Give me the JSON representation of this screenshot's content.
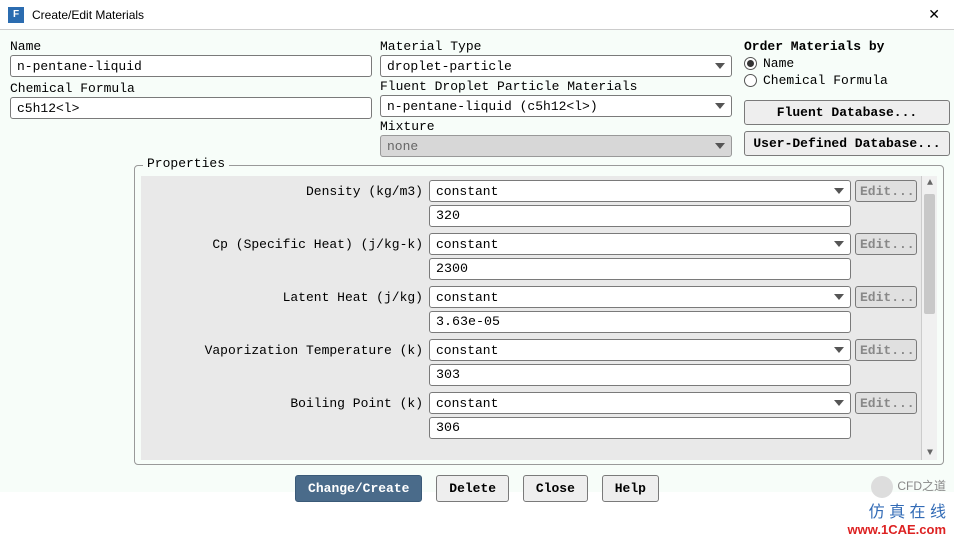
{
  "title": "Create/Edit Materials",
  "name_label": "Name",
  "name_value": "n-pentane-liquid",
  "formula_label": "Chemical Formula",
  "formula_value": "c5h12<l>",
  "mat_type_label": "Material Type",
  "mat_type_value": "droplet-particle",
  "fluent_mat_label": "Fluent Droplet Particle Materials",
  "fluent_mat_value": "n-pentane-liquid (c5h12<l>)",
  "mixture_label": "Mixture",
  "mixture_value": "none",
  "order_label": "Order Materials by",
  "order_opt1": "Name",
  "order_opt2": "Chemical Formula",
  "fluent_db_btn": "Fluent Database...",
  "user_db_btn": "User-Defined Database...",
  "properties_legend": "Properties",
  "props": [
    {
      "label": "Density (kg/m3)",
      "method": "constant",
      "value": "320"
    },
    {
      "label": "Cp (Specific Heat) (j/kg-k)",
      "method": "constant",
      "value": "2300"
    },
    {
      "label": "Latent Heat (j/kg)",
      "method": "constant",
      "value": "3.63e-05"
    },
    {
      "label": "Vaporization Temperature (k)",
      "method": "constant",
      "value": "303"
    },
    {
      "label": "Boiling Point (k)",
      "method": "constant",
      "value": "306"
    }
  ],
  "edit_label": "Edit...",
  "buttons": {
    "change": "Change/Create",
    "delete": "Delete",
    "close": "Close",
    "help": "Help"
  },
  "watermark": {
    "l1": "CFD之道",
    "l2": "仿 真 在 线",
    "l3": "www.1CAE.com"
  }
}
